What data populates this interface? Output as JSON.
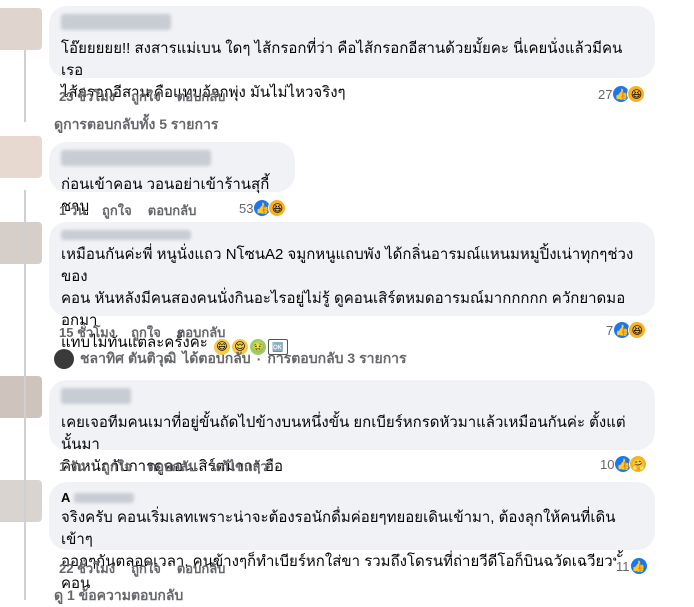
{
  "comments": [
    {
      "text_lines": [
        "โอ๊ยยยยย!! สงสารแม่เบน ใดๆ ไส้กรอกที่ว่า คือไส้กรอกอีสานด้วยมั้ยคะ นี่เคยนั่งแล้วมีคนเรอ",
        "ไส้กรอกอีสาน คือแทบอ้วกพุ่ง มันไม่ไหวจริงๆ"
      ],
      "time": "23 ชั่วโมง",
      "like": "ถูกใจ",
      "reply": "ตอบกลับ",
      "reactions": "27"
    },
    {
      "text_lines": [
        "ก่อนเข้าคอน วอนอย่าเข้าร้านสุกี้ ชาบู"
      ],
      "time": "1 วัน",
      "like": "ถูกใจ",
      "reply": "ตอบกลับ",
      "reactions": "53"
    },
    {
      "text_lines": [
        "เหมือนกันค่ะพี่ หนูนั่งแถว NโซนA2 จมูกหนูแถบพัง ได้กลิ่นอารมณ์แหนมหมูปิ้งเน่าทุกๆช่วงของ",
        "คอน หันหลังมีคนสองคนนั่งกินอะไรอยู่ไม่รู้ ดูคอนเสิร์ตหมดอารมณ์มากกกกก ควักยาดมออกมา",
        "แทบไม่ทันแต่ละครั้งค่ะ"
      ],
      "time": "15 ชั่วโมง",
      "like": "ถูกใจ",
      "reply": "ตอบกลับ",
      "reactions": "7"
    },
    {
      "text_lines": [
        "เคยเจอทีมคนเมาที่อยู่ขั้นถัดไปข้างบนหนึ่งขั้น ยกเบียร์หกรดหัวมาแล้วเหมือนกันค่ะ ตั้งแต่นั้นมา",
        "คิดหนักกับการดูคอนเสิร์ตมากๆ ฮือ"
      ],
      "time": "1 วัน",
      "like": "ถูกใจ",
      "reply": "ตอบกลับ",
      "edited": "แก้ไขแล้ว",
      "reactions": "10"
    },
    {
      "author_initial": "A",
      "text_lines": [
        "จริงครับ คอนเริ่มเลทเพราะน่าจะต้องรอนักดื่มค่อยๆทยอยเดินเข้ามา, ต้องลุกให้คนที่เดินเข้าๆ",
        "ออกๆกันตลอดเวลา, คนข้างๆก็ทำเบียร์หกใส่ขา รวมถึงโดรนที่ถ่ายวีดีโอก็บินฉวัดเฉวียวทั้งคอน"
      ],
      "time": "22 ชั่วโมง",
      "like": "ถูกใจ",
      "reply": "ตอบกลับ",
      "reactions": "11"
    }
  ],
  "view_all_replies": "ดูการตอบกลับทั้ง 5 รายการ",
  "reply_summary": {
    "name": "ชลาทิศ ตันติวุฒิ",
    "action": "ได้ตอบกลับ",
    "dot": "·",
    "count": "การตอบกลับ 3 รายการ"
  },
  "view_one_reply": "ดู 1 ข้อความตอบกลับ",
  "emoji_badge": "🆗"
}
